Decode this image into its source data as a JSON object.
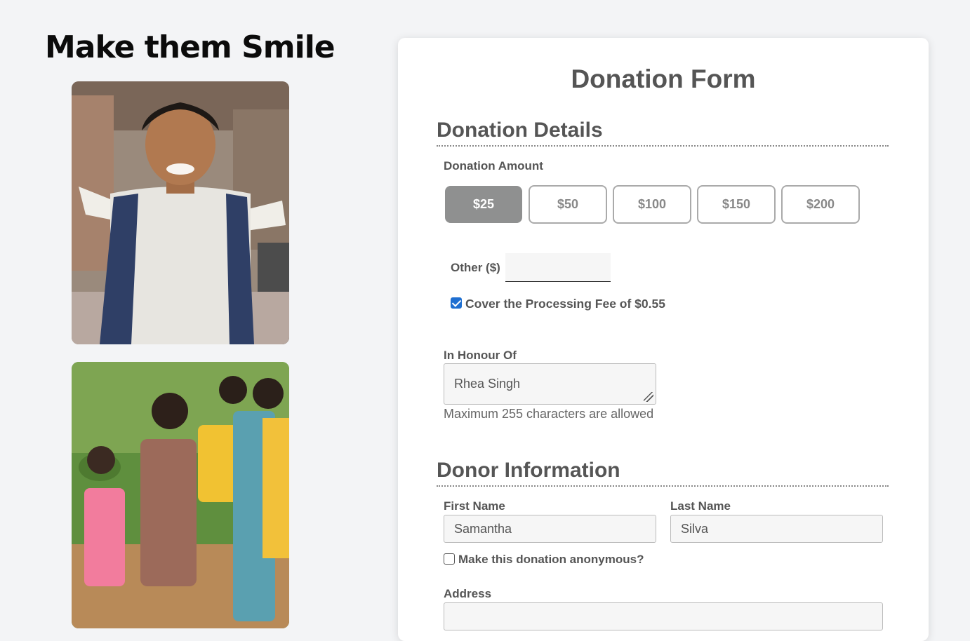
{
  "headline": "Make them Smile",
  "images": [
    {
      "alt": "Smiling boy with school backpack"
    },
    {
      "alt": "Group of children walking outdoors"
    }
  ],
  "form": {
    "title": "Donation Form",
    "donation_details": {
      "heading": "Donation Details",
      "amount_label": "Donation Amount",
      "amounts": [
        "$25",
        "$50",
        "$100",
        "$150",
        "$200"
      ],
      "selected_amount": "$25",
      "other_label": "Other ($)",
      "other_value": "",
      "processing_fee_label": "Cover the Processing Fee of $0.55",
      "processing_fee_checked": true,
      "honour_label": "In Honour Of",
      "honour_value": "Rhea Singh",
      "honour_help": "Maximum 255 characters are allowed"
    },
    "donor_information": {
      "heading": "Donor Information",
      "first_name_label": "First Name",
      "first_name_value": "Samantha",
      "last_name_label": "Last Name",
      "last_name_value": "Silva",
      "anonymous_label": "Make this donation anonymous?",
      "anonymous_checked": false,
      "address_label": "Address",
      "address_value": ""
    }
  },
  "colors": {
    "page_bg": "#f3f4f6",
    "selected_button": "#8f9090",
    "checkbox_accent": "#1f6fd1"
  }
}
